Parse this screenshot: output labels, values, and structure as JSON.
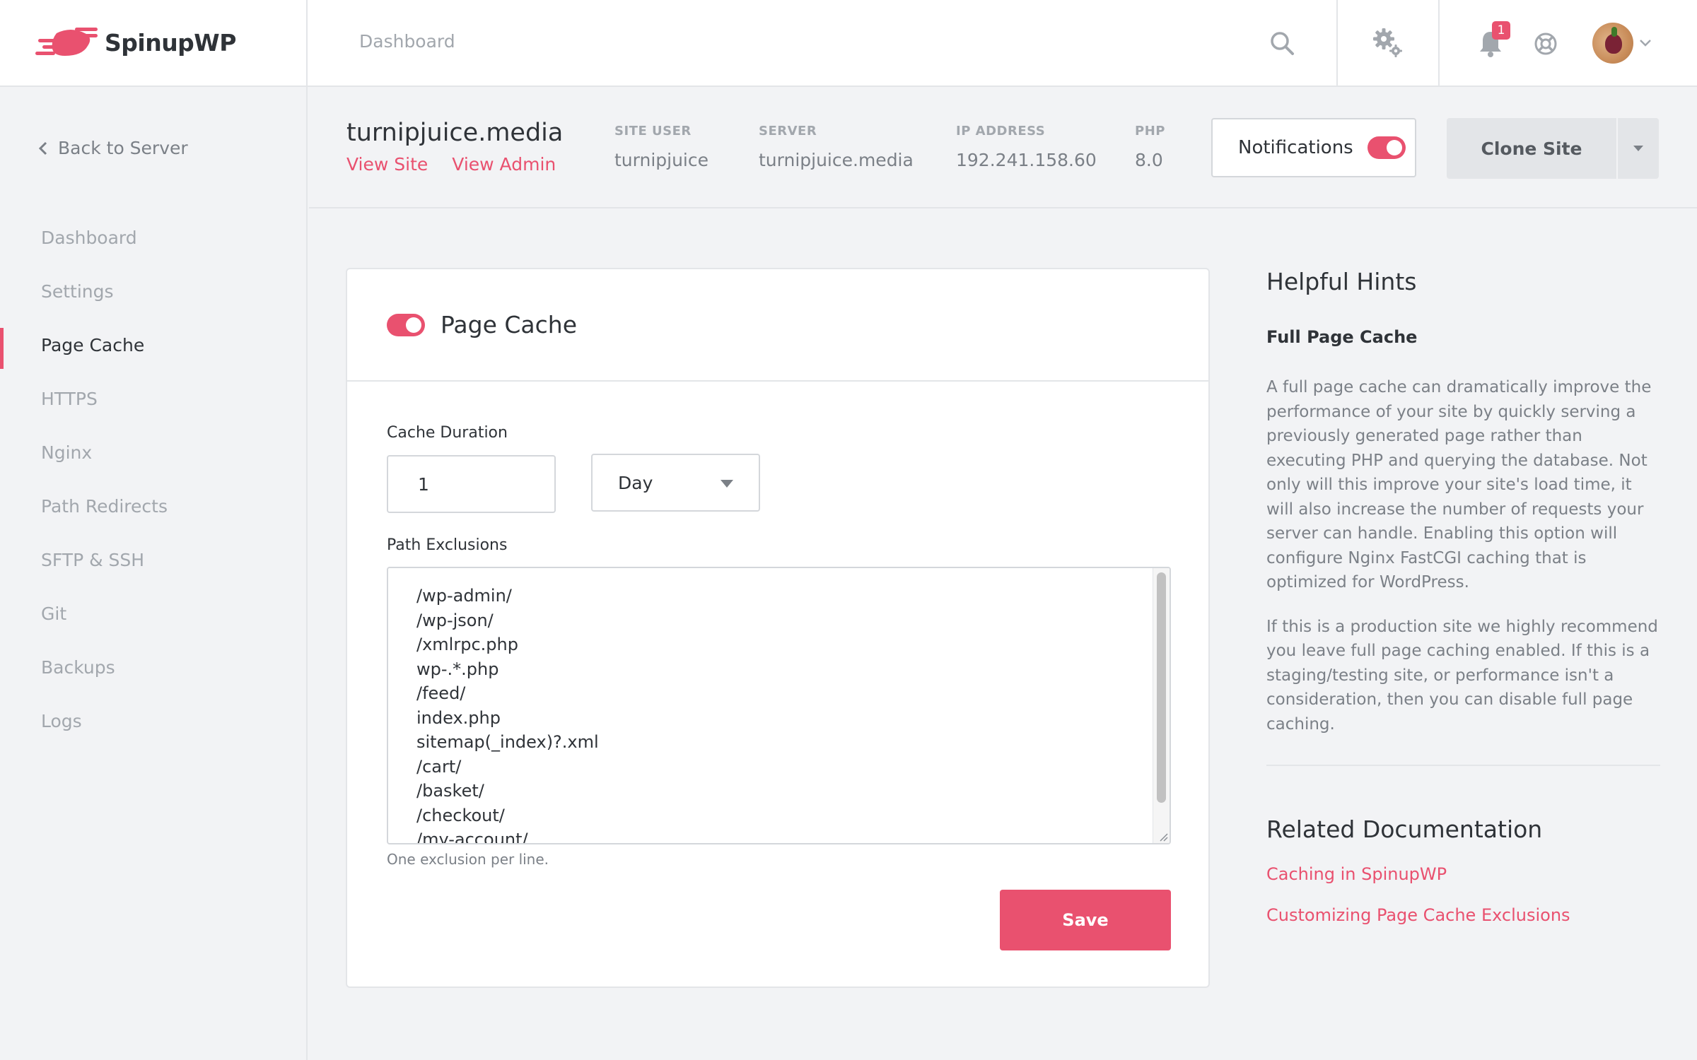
{
  "brand": {
    "name": "SpinupWP",
    "accent": "#e9516f"
  },
  "topbar": {
    "breadcrumb": "Dashboard",
    "notification_count": "1",
    "icons": [
      "search-icon",
      "gear-icon",
      "bell-icon",
      "lifebuoy-icon",
      "chevron-down-icon"
    ]
  },
  "sidebar": {
    "back_label": "Back to Server",
    "items": [
      {
        "label": "Dashboard",
        "active": false
      },
      {
        "label": "Settings",
        "active": false
      },
      {
        "label": "Page Cache",
        "active": true
      },
      {
        "label": "HTTPS",
        "active": false
      },
      {
        "label": "Nginx",
        "active": false
      },
      {
        "label": "Path Redirects",
        "active": false
      },
      {
        "label": "SFTP & SSH",
        "active": false
      },
      {
        "label": "Git",
        "active": false
      },
      {
        "label": "Backups",
        "active": false
      },
      {
        "label": "Logs",
        "active": false
      }
    ]
  },
  "site": {
    "name": "turnipjuice.media",
    "view_site": "View Site",
    "view_admin": "View Admin",
    "meta": [
      {
        "label": "SITE USER",
        "value": "turnipjuice"
      },
      {
        "label": "SERVER",
        "value": "turnipjuice.media"
      },
      {
        "label": "IP ADDRESS",
        "value": "192.241.158.60"
      },
      {
        "label": "PHP",
        "value": "8.0"
      }
    ],
    "notifications_label": "Notifications",
    "notifications_enabled": true,
    "clone_label": "Clone Site"
  },
  "cache": {
    "title": "Page Cache",
    "enabled": true,
    "duration_label": "Cache Duration",
    "duration_value": "1",
    "unit_selected": "Day",
    "exclusions_label": "Path Exclusions",
    "exclusions": [
      "/wp-admin/",
      "/wp-json/",
      "/xmlrpc.php",
      "wp-.*.php",
      "/feed/",
      "index.php",
      "sitemap(_index)?.xml",
      "/cart/",
      "/basket/",
      "/checkout/",
      "/my-account/"
    ],
    "help": "One exclusion per line.",
    "save_label": "Save"
  },
  "hints": {
    "title": "Helpful Hints",
    "subtitle": "Full Page Cache",
    "paragraphs": [
      "A full page cache can dramatically improve the performance of your site by quickly serving a previously generated page rather than executing PHP and querying the database. Not only will this improve your site's load time, it will also increase the number of requests your server can handle. Enabling this option will configure Nginx FastCGI caching that is optimized for WordPress.",
      "If this is a production site we highly recommend you leave full page caching enabled. If this is a staging/testing site, or performance isn't a consideration, then you can disable full page caching."
    ],
    "docs_title": "Related Documentation",
    "docs": [
      "Caching in SpinupWP",
      "Customizing Page Cache Exclusions"
    ]
  }
}
